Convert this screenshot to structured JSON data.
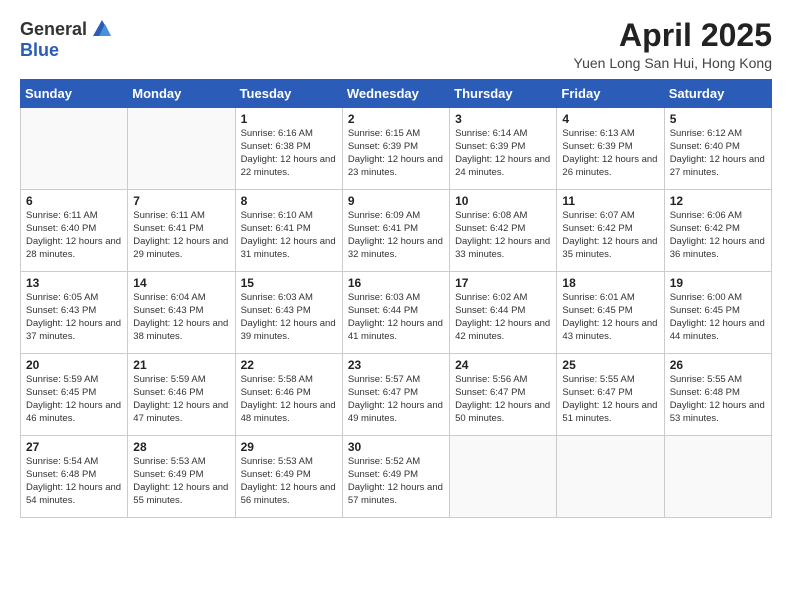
{
  "header": {
    "logo_general": "General",
    "logo_blue": "Blue",
    "month_title": "April 2025",
    "location": "Yuen Long San Hui, Hong Kong"
  },
  "weekdays": [
    "Sunday",
    "Monday",
    "Tuesday",
    "Wednesday",
    "Thursday",
    "Friday",
    "Saturday"
  ],
  "weeks": [
    [
      {
        "day": "",
        "sunrise": "",
        "sunset": "",
        "daylight": ""
      },
      {
        "day": "",
        "sunrise": "",
        "sunset": "",
        "daylight": ""
      },
      {
        "day": "1",
        "sunrise": "Sunrise: 6:16 AM",
        "sunset": "Sunset: 6:38 PM",
        "daylight": "Daylight: 12 hours and 22 minutes."
      },
      {
        "day": "2",
        "sunrise": "Sunrise: 6:15 AM",
        "sunset": "Sunset: 6:39 PM",
        "daylight": "Daylight: 12 hours and 23 minutes."
      },
      {
        "day": "3",
        "sunrise": "Sunrise: 6:14 AM",
        "sunset": "Sunset: 6:39 PM",
        "daylight": "Daylight: 12 hours and 24 minutes."
      },
      {
        "day": "4",
        "sunrise": "Sunrise: 6:13 AM",
        "sunset": "Sunset: 6:39 PM",
        "daylight": "Daylight: 12 hours and 26 minutes."
      },
      {
        "day": "5",
        "sunrise": "Sunrise: 6:12 AM",
        "sunset": "Sunset: 6:40 PM",
        "daylight": "Daylight: 12 hours and 27 minutes."
      }
    ],
    [
      {
        "day": "6",
        "sunrise": "Sunrise: 6:11 AM",
        "sunset": "Sunset: 6:40 PM",
        "daylight": "Daylight: 12 hours and 28 minutes."
      },
      {
        "day": "7",
        "sunrise": "Sunrise: 6:11 AM",
        "sunset": "Sunset: 6:41 PM",
        "daylight": "Daylight: 12 hours and 29 minutes."
      },
      {
        "day": "8",
        "sunrise": "Sunrise: 6:10 AM",
        "sunset": "Sunset: 6:41 PM",
        "daylight": "Daylight: 12 hours and 31 minutes."
      },
      {
        "day": "9",
        "sunrise": "Sunrise: 6:09 AM",
        "sunset": "Sunset: 6:41 PM",
        "daylight": "Daylight: 12 hours and 32 minutes."
      },
      {
        "day": "10",
        "sunrise": "Sunrise: 6:08 AM",
        "sunset": "Sunset: 6:42 PM",
        "daylight": "Daylight: 12 hours and 33 minutes."
      },
      {
        "day": "11",
        "sunrise": "Sunrise: 6:07 AM",
        "sunset": "Sunset: 6:42 PM",
        "daylight": "Daylight: 12 hours and 35 minutes."
      },
      {
        "day": "12",
        "sunrise": "Sunrise: 6:06 AM",
        "sunset": "Sunset: 6:42 PM",
        "daylight": "Daylight: 12 hours and 36 minutes."
      }
    ],
    [
      {
        "day": "13",
        "sunrise": "Sunrise: 6:05 AM",
        "sunset": "Sunset: 6:43 PM",
        "daylight": "Daylight: 12 hours and 37 minutes."
      },
      {
        "day": "14",
        "sunrise": "Sunrise: 6:04 AM",
        "sunset": "Sunset: 6:43 PM",
        "daylight": "Daylight: 12 hours and 38 minutes."
      },
      {
        "day": "15",
        "sunrise": "Sunrise: 6:03 AM",
        "sunset": "Sunset: 6:43 PM",
        "daylight": "Daylight: 12 hours and 39 minutes."
      },
      {
        "day": "16",
        "sunrise": "Sunrise: 6:03 AM",
        "sunset": "Sunset: 6:44 PM",
        "daylight": "Daylight: 12 hours and 41 minutes."
      },
      {
        "day": "17",
        "sunrise": "Sunrise: 6:02 AM",
        "sunset": "Sunset: 6:44 PM",
        "daylight": "Daylight: 12 hours and 42 minutes."
      },
      {
        "day": "18",
        "sunrise": "Sunrise: 6:01 AM",
        "sunset": "Sunset: 6:45 PM",
        "daylight": "Daylight: 12 hours and 43 minutes."
      },
      {
        "day": "19",
        "sunrise": "Sunrise: 6:00 AM",
        "sunset": "Sunset: 6:45 PM",
        "daylight": "Daylight: 12 hours and 44 minutes."
      }
    ],
    [
      {
        "day": "20",
        "sunrise": "Sunrise: 5:59 AM",
        "sunset": "Sunset: 6:45 PM",
        "daylight": "Daylight: 12 hours and 46 minutes."
      },
      {
        "day": "21",
        "sunrise": "Sunrise: 5:59 AM",
        "sunset": "Sunset: 6:46 PM",
        "daylight": "Daylight: 12 hours and 47 minutes."
      },
      {
        "day": "22",
        "sunrise": "Sunrise: 5:58 AM",
        "sunset": "Sunset: 6:46 PM",
        "daylight": "Daylight: 12 hours and 48 minutes."
      },
      {
        "day": "23",
        "sunrise": "Sunrise: 5:57 AM",
        "sunset": "Sunset: 6:47 PM",
        "daylight": "Daylight: 12 hours and 49 minutes."
      },
      {
        "day": "24",
        "sunrise": "Sunrise: 5:56 AM",
        "sunset": "Sunset: 6:47 PM",
        "daylight": "Daylight: 12 hours and 50 minutes."
      },
      {
        "day": "25",
        "sunrise": "Sunrise: 5:55 AM",
        "sunset": "Sunset: 6:47 PM",
        "daylight": "Daylight: 12 hours and 51 minutes."
      },
      {
        "day": "26",
        "sunrise": "Sunrise: 5:55 AM",
        "sunset": "Sunset: 6:48 PM",
        "daylight": "Daylight: 12 hours and 53 minutes."
      }
    ],
    [
      {
        "day": "27",
        "sunrise": "Sunrise: 5:54 AM",
        "sunset": "Sunset: 6:48 PM",
        "daylight": "Daylight: 12 hours and 54 minutes."
      },
      {
        "day": "28",
        "sunrise": "Sunrise: 5:53 AM",
        "sunset": "Sunset: 6:49 PM",
        "daylight": "Daylight: 12 hours and 55 minutes."
      },
      {
        "day": "29",
        "sunrise": "Sunrise: 5:53 AM",
        "sunset": "Sunset: 6:49 PM",
        "daylight": "Daylight: 12 hours and 56 minutes."
      },
      {
        "day": "30",
        "sunrise": "Sunrise: 5:52 AM",
        "sunset": "Sunset: 6:49 PM",
        "daylight": "Daylight: 12 hours and 57 minutes."
      },
      {
        "day": "",
        "sunrise": "",
        "sunset": "",
        "daylight": ""
      },
      {
        "day": "",
        "sunrise": "",
        "sunset": "",
        "daylight": ""
      },
      {
        "day": "",
        "sunrise": "",
        "sunset": "",
        "daylight": ""
      }
    ]
  ]
}
